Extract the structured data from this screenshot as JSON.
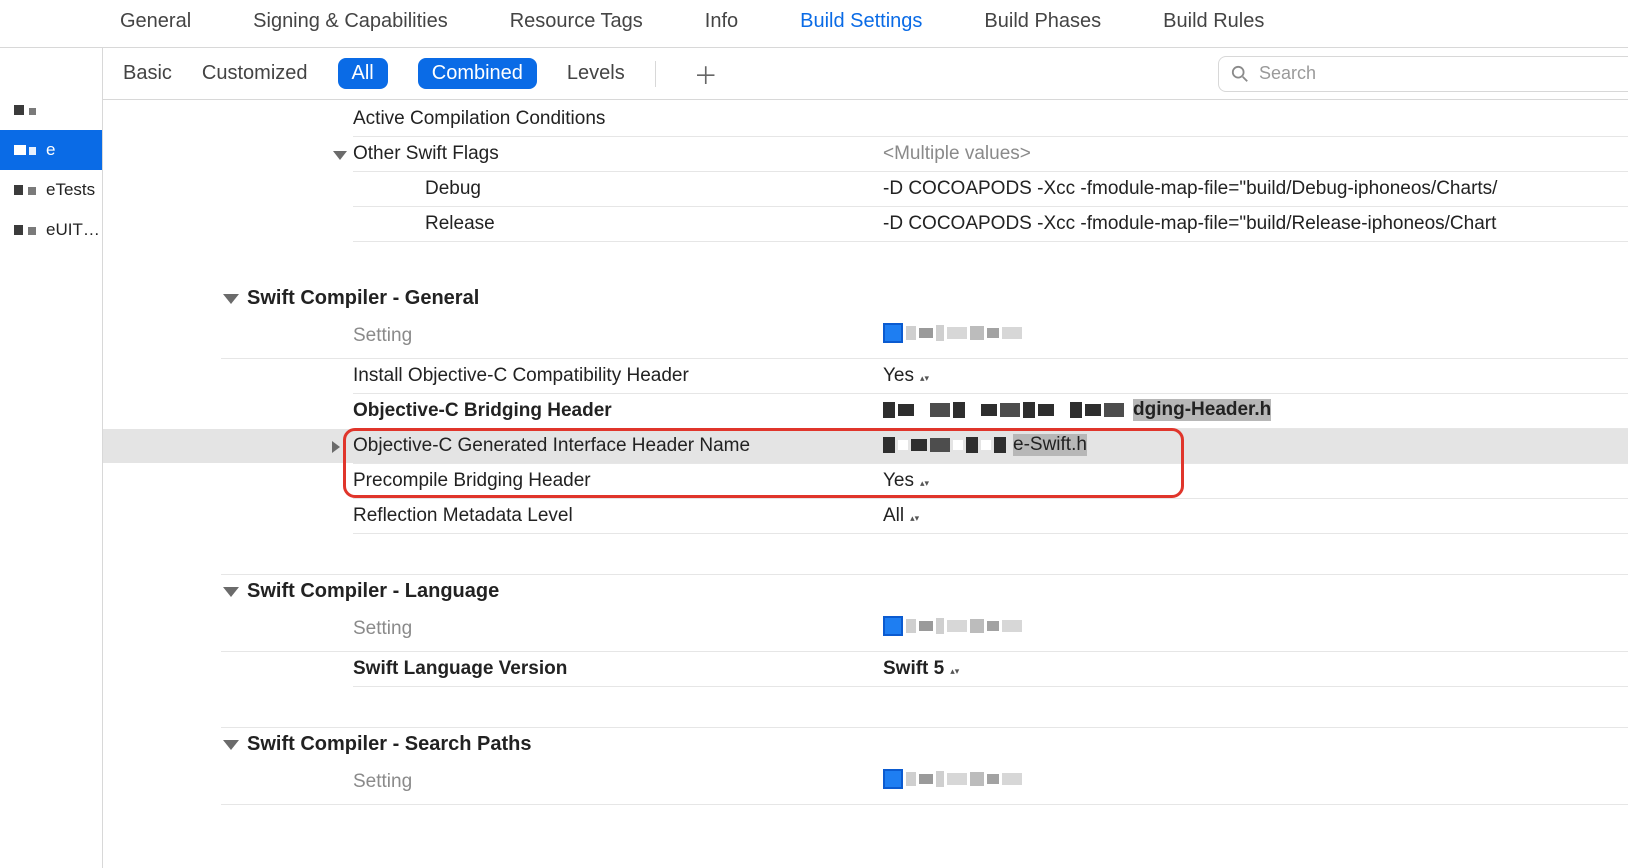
{
  "tabs": {
    "general": "General",
    "signing": "Signing & Capabilities",
    "resource": "Resource Tags",
    "info": "Info",
    "buildSettings": "Build Settings",
    "buildPhases": "Build Phases",
    "buildRules": "Build Rules"
  },
  "sidebar": {
    "items": [
      "e",
      "eTests",
      "eUIT…"
    ]
  },
  "toolbar": {
    "basic": "Basic",
    "customized": "Customized",
    "all": "All",
    "combined": "Combined",
    "levels": "Levels",
    "searchPlaceholder": "Search"
  },
  "s": {
    "activeComp": "Active Compilation Conditions",
    "otherSwift": "Other Swift Flags",
    "otherSwiftVal": "<Multiple values>",
    "debug": "Debug",
    "debugVal": "-D COCOAPODS -Xcc -fmodule-map-file=\"build/Debug-iphoneos/Charts/",
    "release": "Release",
    "releaseVal": "-D COCOAPODS -Xcc -fmodule-map-file=\"build/Release-iphoneos/Chart",
    "sec1": "Swift Compiler - General",
    "settingLbl": "Setting",
    "installObjC": "Install Objective-C Compatibility Header",
    "installObjCVal": "Yes",
    "bridging": "Objective-C Bridging Header",
    "bridgingTail": "dging-Header.h",
    "genHeader": "Objective-C Generated Interface Header Name",
    "genHeaderTail": "e-Swift.h",
    "precompile": "Precompile Bridging Header",
    "precompileVal": "Yes",
    "reflection": "Reflection Metadata Level",
    "reflectionVal": "All",
    "sec2": "Swift Compiler - Language",
    "swiftLang": "Swift Language Version",
    "swiftLangVal": "Swift 5",
    "sec3": "Swift Compiler - Search Paths"
  }
}
